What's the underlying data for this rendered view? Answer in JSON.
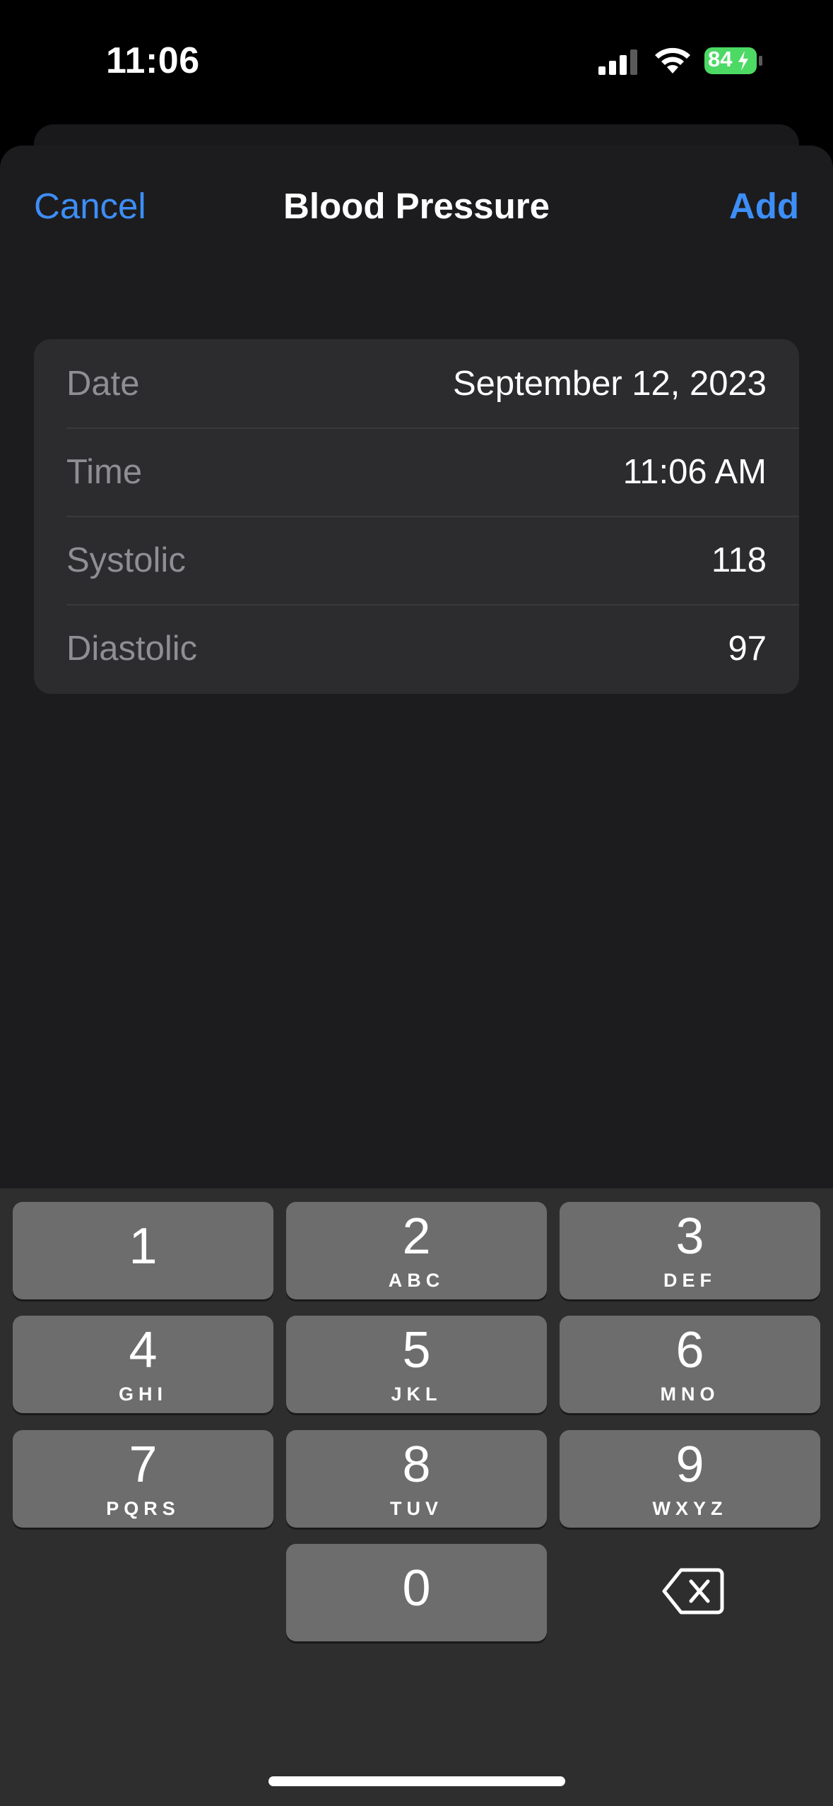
{
  "status_bar": {
    "time": "11:06",
    "battery_level": "84",
    "battery_color": "#4cd964"
  },
  "nav": {
    "cancel_label": "Cancel",
    "title": "Blood Pressure",
    "add_label": "Add",
    "accent_color": "#3d8ef7"
  },
  "form": {
    "rows": [
      {
        "label": "Date",
        "value": "September 12, 2023"
      },
      {
        "label": "Time",
        "value": "11:06 AM"
      },
      {
        "label": "Systolic",
        "value": "118"
      },
      {
        "label": "Diastolic",
        "value": "97"
      }
    ]
  },
  "keypad": {
    "keys": [
      {
        "digit": "1",
        "letters": ""
      },
      {
        "digit": "2",
        "letters": "ABC"
      },
      {
        "digit": "3",
        "letters": "DEF"
      },
      {
        "digit": "4",
        "letters": "GHI"
      },
      {
        "digit": "5",
        "letters": "JKL"
      },
      {
        "digit": "6",
        "letters": "MNO"
      },
      {
        "digit": "7",
        "letters": "PQRS"
      },
      {
        "digit": "8",
        "letters": "TUV"
      },
      {
        "digit": "9",
        "letters": "WXYZ"
      },
      {
        "digit": "0",
        "letters": ""
      }
    ],
    "delete_icon": "delete-backspace-icon"
  }
}
